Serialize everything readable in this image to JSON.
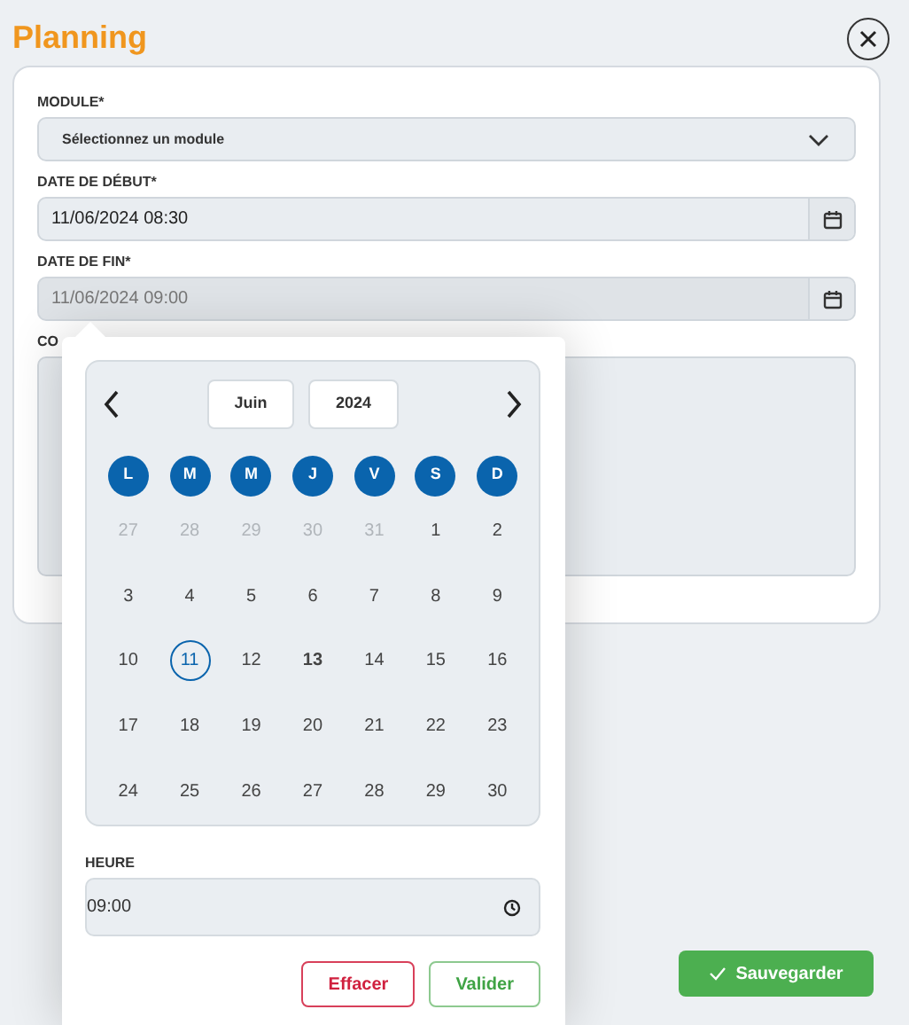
{
  "title": "Planning",
  "form": {
    "fields": [
      {
        "kind": "select",
        "label": "MODULE*",
        "value": "Sélectionnez un module"
      },
      {
        "kind": "datetime",
        "label": "DATE DE DÉBUT*",
        "value": "11/06/2024 08:30",
        "disabled": false
      },
      {
        "kind": "datetime",
        "label": "DATE DE FIN*",
        "value": "11/06/2024 09:00",
        "disabled": true
      },
      {
        "kind": "textarea",
        "label": "CO"
      }
    ]
  },
  "datepicker": {
    "month": "Juin",
    "year": "2024",
    "weekdays": [
      "L",
      "M",
      "M",
      "J",
      "V",
      "S",
      "D"
    ],
    "weeks": [
      [
        {
          "day": "27",
          "outside": true,
          "selected": false,
          "today": false
        },
        {
          "day": "28",
          "outside": true,
          "selected": false,
          "today": false
        },
        {
          "day": "29",
          "outside": true,
          "selected": false,
          "today": false
        },
        {
          "day": "30",
          "outside": true,
          "selected": false,
          "today": false
        },
        {
          "day": "31",
          "outside": true,
          "selected": false,
          "today": false
        },
        {
          "day": "1",
          "outside": false,
          "selected": false,
          "today": false
        },
        {
          "day": "2",
          "outside": false,
          "selected": false,
          "today": false
        }
      ],
      [
        {
          "day": "3",
          "outside": false,
          "selected": false,
          "today": false
        },
        {
          "day": "4",
          "outside": false,
          "selected": false,
          "today": false
        },
        {
          "day": "5",
          "outside": false,
          "selected": false,
          "today": false
        },
        {
          "day": "6",
          "outside": false,
          "selected": false,
          "today": false
        },
        {
          "day": "7",
          "outside": false,
          "selected": false,
          "today": false
        },
        {
          "day": "8",
          "outside": false,
          "selected": false,
          "today": false
        },
        {
          "day": "9",
          "outside": false,
          "selected": false,
          "today": false
        }
      ],
      [
        {
          "day": "10",
          "outside": false,
          "selected": false,
          "today": false
        },
        {
          "day": "11",
          "outside": false,
          "selected": true,
          "today": false
        },
        {
          "day": "12",
          "outside": false,
          "selected": false,
          "today": false
        },
        {
          "day": "13",
          "outside": false,
          "selected": false,
          "today": true
        },
        {
          "day": "14",
          "outside": false,
          "selected": false,
          "today": false
        },
        {
          "day": "15",
          "outside": false,
          "selected": false,
          "today": false
        },
        {
          "day": "16",
          "outside": false,
          "selected": false,
          "today": false
        }
      ],
      [
        {
          "day": "17",
          "outside": false,
          "selected": false,
          "today": false
        },
        {
          "day": "18",
          "outside": false,
          "selected": false,
          "today": false
        },
        {
          "day": "19",
          "outside": false,
          "selected": false,
          "today": false
        },
        {
          "day": "20",
          "outside": false,
          "selected": false,
          "today": false
        },
        {
          "day": "21",
          "outside": false,
          "selected": false,
          "today": false
        },
        {
          "day": "22",
          "outside": false,
          "selected": false,
          "today": false
        },
        {
          "day": "23",
          "outside": false,
          "selected": false,
          "today": false
        }
      ],
      [
        {
          "day": "24",
          "outside": false,
          "selected": false,
          "today": false
        },
        {
          "day": "25",
          "outside": false,
          "selected": false,
          "today": false
        },
        {
          "day": "26",
          "outside": false,
          "selected": false,
          "today": false
        },
        {
          "day": "27",
          "outside": false,
          "selected": false,
          "today": false
        },
        {
          "day": "28",
          "outside": false,
          "selected": false,
          "today": false
        },
        {
          "day": "29",
          "outside": false,
          "selected": false,
          "today": false
        },
        {
          "day": "30",
          "outside": false,
          "selected": false,
          "today": false
        }
      ]
    ],
    "time_label": "HEURE",
    "time_value": "09:00",
    "buttons": [
      {
        "kind": "danger",
        "label": "Effacer"
      },
      {
        "kind": "success",
        "label": "Valider"
      }
    ]
  },
  "save_button": "Sauvegarder"
}
